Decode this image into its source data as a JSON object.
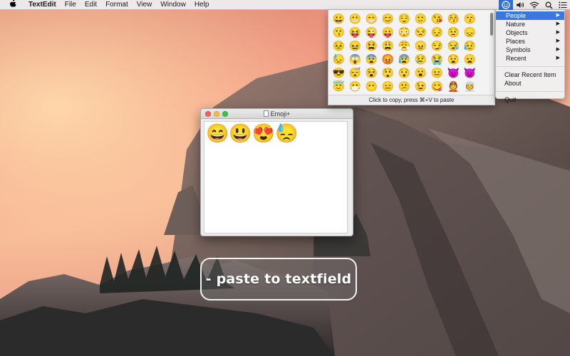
{
  "menubar": {
    "apple_icon": "apple-logo-icon",
    "app_name": "TextEdit",
    "menus": [
      "File",
      "Edit",
      "Format",
      "View",
      "Window",
      "Help"
    ],
    "status_icons": [
      "emoji-smiley-icon",
      "volume-icon",
      "wifi-icon",
      "search-icon",
      "list-icon"
    ]
  },
  "dropdown": {
    "categories": [
      {
        "label": "People",
        "selected": true
      },
      {
        "label": "Nature"
      },
      {
        "label": "Objects"
      },
      {
        "label": "Places"
      },
      {
        "label": "Symbols"
      },
      {
        "label": "Recent"
      }
    ],
    "clear_recent": "Clear Recent Item",
    "about": "About",
    "quit": "Quit",
    "selection_color": "#3a78df"
  },
  "picker": {
    "emojis": [
      "😀",
      "😬",
      "😁",
      "😊",
      "😌",
      "🙂",
      "😘",
      "😚",
      "😙",
      "😗",
      "😝",
      "😜",
      "😛",
      "😳",
      "😒",
      "😔",
      "😟",
      "😞",
      "😣",
      "😖",
      "😫",
      "😩",
      "😤",
      "😠",
      "😏",
      "😪",
      "😥",
      "😓",
      "😱",
      "😨",
      "😡",
      "😰",
      "😢",
      "😭",
      "😧",
      "😦",
      "😎",
      "😴",
      "😵",
      "😲",
      "😯",
      "😮",
      "😐",
      "😈",
      "👿",
      "😇",
      "😷",
      "😶",
      "😑",
      "😕",
      "😉",
      "😋",
      "👲",
      "👳"
    ],
    "footer": "Click to copy, press ⌘+V to paste"
  },
  "window": {
    "title": "Emoji+",
    "text": "😄😃😍😓"
  },
  "caption": {
    "text": "- paste to textfield"
  }
}
